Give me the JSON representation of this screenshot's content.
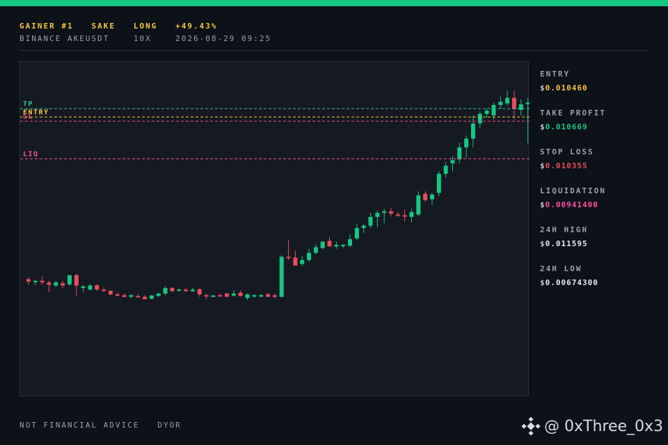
{
  "header": {
    "line1": "GAINER #1   SAKE   LONG   +49.43%",
    "line2": "BINANCE AKEUSDT    10X    2026-08-29 09:25"
  },
  "chart_data": {
    "type": "candlestick",
    "symbol": "AKEUSDT",
    "ylim": [
      0.00345,
      0.01184
    ],
    "levels": [
      {
        "label": "TP",
        "value": 0.010669,
        "color": "#2ec4a0"
      },
      {
        "label": "ENTRY",
        "value": 0.01046,
        "color": "#f5c542"
      },
      {
        "label": "SL",
        "value": 0.010355,
        "color": "#f0506e"
      },
      {
        "label": "LIQ",
        "value": 0.009414,
        "color": "#ff4fa3"
      }
    ],
    "colors": {
      "up": "#16c784",
      "down": "#ea4d5c"
    },
    "candles": [
      [
        0.0064,
        0.00645,
        0.00626,
        0.00634
      ],
      [
        0.00634,
        0.00638,
        0.00626,
        0.00636
      ],
      [
        0.00636,
        0.00648,
        0.00626,
        0.00632
      ],
      [
        0.00632,
        0.00636,
        0.00608,
        0.00626
      ],
      [
        0.00624,
        0.00636,
        0.0062,
        0.00632
      ],
      [
        0.0063,
        0.00636,
        0.00618,
        0.00624
      ],
      [
        0.00627,
        0.0065,
        0.00623,
        0.0065
      ],
      [
        0.0065,
        0.00654,
        0.00598,
        0.00624
      ],
      [
        0.00618,
        0.00626,
        0.00608,
        0.00622
      ],
      [
        0.00614,
        0.00628,
        0.00612,
        0.00624
      ],
      [
        0.00625,
        0.00627,
        0.0061,
        0.00614
      ],
      [
        0.00614,
        0.0062,
        0.00608,
        0.00612
      ],
      [
        0.00611,
        0.00612,
        0.006,
        0.00602
      ],
      [
        0.00602,
        0.00606,
        0.00597,
        0.00601
      ],
      [
        0.006,
        0.00604,
        0.00594,
        0.00596
      ],
      [
        0.00596,
        0.00602,
        0.00592,
        0.006
      ],
      [
        0.00598,
        0.00602,
        0.00594,
        0.00596
      ],
      [
        0.00596,
        0.006,
        0.0059,
        0.0059
      ],
      [
        0.00591,
        0.00601,
        0.00589,
        0.00599
      ],
      [
        0.00598,
        0.00606,
        0.00596,
        0.00604
      ],
      [
        0.00604,
        0.00623,
        0.006,
        0.00618
      ],
      [
        0.00618,
        0.0062,
        0.00608,
        0.0061
      ],
      [
        0.00611,
        0.00617,
        0.0061,
        0.00614
      ],
      [
        0.00614,
        0.00618,
        0.00608,
        0.0061
      ],
      [
        0.0061,
        0.00618,
        0.00608,
        0.00614
      ],
      [
        0.00615,
        0.00617,
        0.00596,
        0.00602
      ],
      [
        0.006,
        0.00603,
        0.0059,
        0.00598
      ],
      [
        0.00598,
        0.00601,
        0.00596,
        0.00599
      ],
      [
        0.006,
        0.00604,
        0.00598,
        0.00598
      ],
      [
        0.00604,
        0.00606,
        0.00596,
        0.00596
      ],
      [
        0.00599,
        0.00612,
        0.00596,
        0.00604
      ],
      [
        0.00606,
        0.00612,
        0.00596,
        0.00598
      ],
      [
        0.00593,
        0.00604,
        0.00588,
        0.00602
      ],
      [
        0.00598,
        0.00602,
        0.00594,
        0.006
      ],
      [
        0.00599,
        0.00603,
        0.00594,
        0.006
      ],
      [
        0.00602,
        0.00606,
        0.00596,
        0.00596
      ],
      [
        0.006,
        0.00604,
        0.00592,
        0.00596
      ],
      [
        0.00596,
        0.007,
        0.00594,
        0.00696
      ],
      [
        0.00696,
        0.00738,
        0.00688,
        0.00694
      ],
      [
        0.00694,
        0.00712,
        0.00676,
        0.00674
      ],
      [
        0.00678,
        0.00698,
        0.00672,
        0.00688
      ],
      [
        0.00688,
        0.00716,
        0.00684,
        0.00706
      ],
      [
        0.00706,
        0.00728,
        0.00702,
        0.0072
      ],
      [
        0.00718,
        0.00736,
        0.00714,
        0.00734
      ],
      [
        0.00736,
        0.00746,
        0.00728,
        0.00722
      ],
      [
        0.00722,
        0.00734,
        0.00716,
        0.00726
      ],
      [
        0.00724,
        0.00728,
        0.00718,
        0.00726
      ],
      [
        0.00724,
        0.00752,
        0.0072,
        0.0074
      ],
      [
        0.00742,
        0.00778,
        0.00738,
        0.00768
      ],
      [
        0.00768,
        0.00778,
        0.00756,
        0.00774
      ],
      [
        0.00774,
        0.00806,
        0.00768,
        0.00796
      ],
      [
        0.00796,
        0.00812,
        0.0077,
        0.00806
      ],
      [
        0.00806,
        0.00816,
        0.0078,
        0.0081
      ],
      [
        0.0081,
        0.00818,
        0.00798,
        0.00804
      ],
      [
        0.00802,
        0.00808,
        0.00796,
        0.008
      ],
      [
        0.008,
        0.00814,
        0.00784,
        0.00798
      ],
      [
        0.00796,
        0.00816,
        0.00782,
        0.00808
      ],
      [
        0.00802,
        0.0086,
        0.00798,
        0.0085
      ],
      [
        0.00854,
        0.0086,
        0.00834,
        0.00838
      ],
      [
        0.0084,
        0.00856,
        0.00826,
        0.00852
      ],
      [
        0.00856,
        0.0091,
        0.00848,
        0.00904
      ],
      [
        0.00904,
        0.00934,
        0.00894,
        0.00924
      ],
      [
        0.0093,
        0.00948,
        0.0091,
        0.00938
      ],
      [
        0.0094,
        0.00982,
        0.0093,
        0.0097
      ],
      [
        0.0097,
        0.01,
        0.00944,
        0.00992
      ],
      [
        0.00992,
        0.0105,
        0.0097,
        0.0103
      ],
      [
        0.0103,
        0.0106,
        0.01018,
        0.01054
      ],
      [
        0.01054,
        0.01068,
        0.01044,
        0.01062
      ],
      [
        0.0105,
        0.01082,
        0.0104,
        0.01076
      ],
      [
        0.01076,
        0.01098,
        0.01066,
        0.01084
      ],
      [
        0.0108,
        0.01112,
        0.01074,
        0.01094
      ],
      [
        0.01094,
        0.01112,
        0.0104,
        0.01066
      ],
      [
        0.01064,
        0.0109,
        0.0105,
        0.01078
      ],
      [
        0.01078,
        0.01094,
        0.0098,
        0.01082
      ],
      [
        0.0107,
        0.01155,
        0.0101,
        0.01004
      ],
      [
        0.01004,
        0.0105,
        0.01,
        0.01016
      ]
    ]
  },
  "sidebar": {
    "stats": [
      {
        "label": "ENTRY",
        "currency": "$",
        "value": "0.010460",
        "color": "#f5c542"
      },
      {
        "label": "TAKE PROFIT",
        "currency": "$",
        "value": "0.010669",
        "color": "#16c784"
      },
      {
        "label": "STOP LOSS",
        "currency": "$",
        "value": "0.010355",
        "color": "#ea4d5c"
      },
      {
        "label": "LIQUIDATION",
        "currency": "$",
        "value": "0.00941400",
        "color": "#ff4fa3"
      },
      {
        "label": "24H HIGH",
        "currency": "$",
        "value": "0.011595",
        "color": "#e8eaee"
      },
      {
        "label": "24H LOW",
        "currency": "$",
        "value": "0.00674300",
        "color": "#e8eaee"
      }
    ]
  },
  "footer": {
    "text": "NOT FINANCIAL ADVICE   DYOR"
  },
  "watermark": {
    "text": "@ 0xThree_0x3",
    "icon": "binance-logo-icon"
  }
}
